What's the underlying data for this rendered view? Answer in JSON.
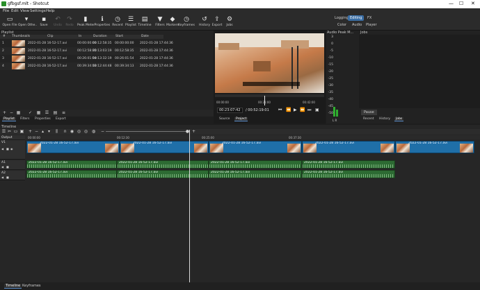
{
  "window": {
    "title": "gfbgsf.mlt - Shotcut",
    "minimize": "—",
    "maximize": "☐",
    "close": "✕"
  },
  "menu": [
    "File",
    "Edit",
    "View",
    "Settings",
    "Help"
  ],
  "toolbar": [
    {
      "label": "Open File",
      "icon": "folder-open-icon",
      "glyph": "▭",
      "enabled": true
    },
    {
      "label": "Open Othe..",
      "icon": "open-other-icon",
      "glyph": "▾",
      "enabled": true
    },
    {
      "label": "Save",
      "icon": "save-icon",
      "glyph": "▪",
      "enabled": true
    },
    {
      "label": "Undo",
      "icon": "undo-icon",
      "glyph": "↶",
      "enabled": false
    },
    {
      "label": "Redo",
      "icon": "redo-icon",
      "glyph": "↷",
      "enabled": false
    },
    {
      "label": "Peak Meter",
      "icon": "peak-meter-icon",
      "glyph": "▮",
      "enabled": true
    },
    {
      "label": "Properties",
      "icon": "properties-icon",
      "glyph": "ℹ",
      "enabled": true
    },
    {
      "label": "Recent",
      "icon": "recent-icon",
      "glyph": "◷",
      "enabled": true
    },
    {
      "label": "Playlist",
      "icon": "playlist-icon",
      "glyph": "☰",
      "enabled": true
    },
    {
      "label": "Timeline",
      "icon": "timeline-icon",
      "glyph": "▤",
      "enabled": true
    },
    {
      "label": "Filters",
      "icon": "filters-icon",
      "glyph": "▼",
      "enabled": true
    },
    {
      "label": "Markers",
      "icon": "markers-icon",
      "glyph": "◆",
      "enabled": true
    },
    {
      "label": "Keyframes",
      "icon": "keyframes-icon",
      "glyph": "◷",
      "enabled": true
    },
    {
      "label": "History",
      "icon": "history-icon",
      "glyph": "↺",
      "enabled": true
    },
    {
      "label": "Export",
      "icon": "export-icon",
      "glyph": "⇪",
      "enabled": true
    },
    {
      "label": "Jobs",
      "icon": "jobs-icon",
      "glyph": "⚙",
      "enabled": true
    }
  ],
  "layouts": {
    "row1": [
      {
        "label": "Logging",
        "active": false
      },
      {
        "label": "Editing",
        "active": true
      },
      {
        "label": "FX",
        "active": false
      }
    ],
    "row2": [
      {
        "label": "Color",
        "active": false
      },
      {
        "label": "Audio",
        "active": false
      },
      {
        "label": "Player",
        "active": false
      }
    ]
  },
  "playlist": {
    "title": "Playlist",
    "columns": [
      "#",
      "Thumbnails",
      "Clip",
      "In",
      "Duration",
      "Start",
      "Date"
    ],
    "rows": [
      [
        "1",
        "2022-01-28 16-52-17.avi",
        "00:00:00:00",
        "00:12:58:35",
        "00:00:00:00",
        "2022-01-28 17:44:36"
      ],
      [
        "2",
        "2022-01-28 16-52-17.avi",
        "00:12:58:35",
        "00:13:03:19",
        "00:12:58:35",
        "2022-01-28 17:44:36"
      ],
      [
        "3",
        "2022-01-28 16-52-17.avi",
        "00:26:01:54",
        "00:13:32:19",
        "00:26:01:54",
        "2022-01-28 17:44:36"
      ],
      [
        "4",
        "2022-01-28 16-52-17.avi",
        "00:39:34:13",
        "00:12:44:48",
        "00:39:34:13",
        "2022-01-28 17:44:36"
      ]
    ],
    "tabs": [
      "Playlist",
      "Filters",
      "Properties",
      "Export"
    ]
  },
  "viewer": {
    "ruler": [
      "00:00:00",
      "00:21:00",
      "00:42:00"
    ],
    "timecode": "00:23:07:42",
    "total": "/ 00:52:19:01",
    "tabs": [
      "Source",
      "Project"
    ]
  },
  "audio_peak": {
    "title": "Audio Peak M...",
    "scale": [
      "3",
      "0",
      "-5",
      "-10",
      "-15",
      "-20",
      "-25",
      "-30",
      "-35",
      "-40",
      "-45",
      "-50"
    ],
    "channels": "L  R",
    "level_db": -45
  },
  "jobs": {
    "title": "Jobs",
    "pause": "Pause",
    "tabs": [
      "Recent",
      "History",
      "Jobs"
    ]
  },
  "timeline": {
    "title": "Timeline",
    "ruler": [
      "00:00:00",
      "00:12:30",
      "00:25:00",
      "00:37:30"
    ],
    "tracks": [
      {
        "name": "Output",
        "kind": "output"
      },
      {
        "name": "V1",
        "kind": "video"
      },
      {
        "name": "A1",
        "kind": "audio"
      },
      {
        "name": "A2",
        "kind": "audio"
      }
    ],
    "clip_label": "2022-01-28 16-52-17.avi"
  },
  "bottom_tabs": [
    "Timeline",
    "Keyframes"
  ]
}
